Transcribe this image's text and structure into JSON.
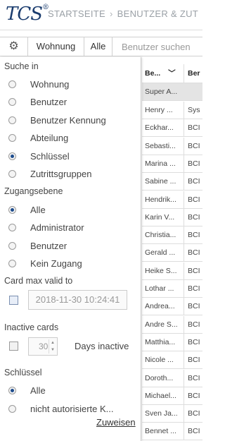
{
  "header": {
    "logo": "TCS",
    "breadcrumb": [
      "STARTSEITE",
      "BENUTZER & ZUT"
    ]
  },
  "toolbar": {
    "settings_icon": "gear-icon",
    "wohnung_label": "Wohnung",
    "alle_label": "Alle",
    "search_placeholder": "Benutzer suchen"
  },
  "filter": {
    "suche_in": {
      "title": "Suche in",
      "options": [
        "Wohnung",
        "Benutzer",
        "Benutzer Kennung",
        "Abteilung",
        "Schlüssel",
        "Zutrittsgruppen"
      ],
      "selected": "Schlüssel"
    },
    "zugangsebene": {
      "title": "Zugangsebene",
      "options": [
        "Alle",
        "Administrator",
        "Benutzer",
        "Kein Zugang"
      ],
      "selected": "Alle"
    },
    "card_max": {
      "title": "Card max valid to",
      "value": "2018-11-30 10:24:41"
    },
    "inactive": {
      "title": "Inactive cards",
      "value": "30",
      "suffix": "Days inactive"
    },
    "schluessel": {
      "title": "Schlüssel",
      "options": [
        "Alle",
        "nicht autorisierte K..."
      ],
      "selected": "Alle"
    },
    "apply_label": "Zuweisen"
  },
  "table": {
    "headers": [
      "Be...",
      "Ber"
    ],
    "group": "Super A...",
    "rows": [
      [
        "Henry ...",
        "Sys"
      ],
      [
        "Eckhar...",
        "BCI"
      ],
      [
        "Sebasti...",
        "BCI"
      ],
      [
        "Marina ...",
        "BCI"
      ],
      [
        "Sabine ...",
        "BCI"
      ],
      [
        "Hendrik...",
        "BCI"
      ],
      [
        "Karin V...",
        "BCI"
      ],
      [
        "Christia...",
        "BCI"
      ],
      [
        "Gerald ...",
        "BCI"
      ],
      [
        "Heike S...",
        "BCI"
      ],
      [
        "Lothar ...",
        "BCI"
      ],
      [
        "Andrea...",
        "BCI"
      ],
      [
        "Andre S...",
        "BCI"
      ],
      [
        "Matthia...",
        "BCI"
      ],
      [
        "Nicole ...",
        "BCI"
      ],
      [
        "Doroth...",
        "BCI"
      ],
      [
        "Michael...",
        "BCI"
      ],
      [
        "Sven Ja...",
        "BCI"
      ],
      [
        "Bennet ...",
        "BCI"
      ]
    ]
  }
}
